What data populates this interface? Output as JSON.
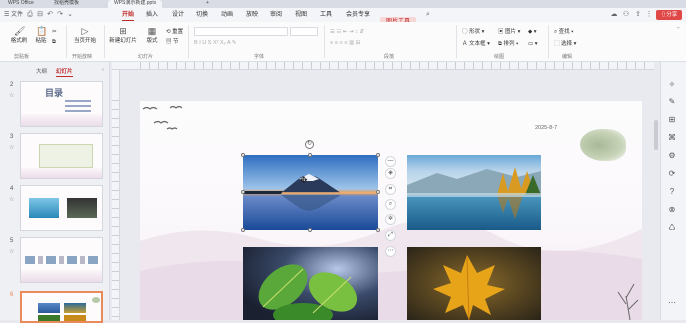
{
  "titlebar": {
    "tabs": [
      {
        "label": "WPS Office"
      },
      {
        "label": "找稻壳模板"
      },
      {
        "label": "WPS演示新建.pptx"
      }
    ],
    "new_tab": "+"
  },
  "menubar": {
    "file_label": "文件",
    "items": [
      "开始",
      "插入",
      "设计",
      "切换",
      "动画",
      "放映",
      "审阅",
      "视图",
      "工具",
      "会员专享"
    ],
    "active_index": 0,
    "picture_tools": "图片工具",
    "share_label": "分享"
  },
  "ribbon": {
    "format_painter": "格式刷",
    "paste": "粘贴",
    "clipboard_group": "剪贴板",
    "play_from_current": "当页开始",
    "play_group": "开始放映",
    "new_slide": "新建幻灯片",
    "layout": "版式",
    "section": "节",
    "reset": "重置",
    "slides_group": "幻灯片",
    "font_group": "字体",
    "paragraph_group": "段落",
    "shape": "形状",
    "textbox": "文本框",
    "picture": "图片",
    "arrange": "排列",
    "drawing_group": "绘图",
    "find": "查找",
    "select": "选择",
    "editing_group": "编辑"
  },
  "leftpanel": {
    "outline_tab": "大纲",
    "slides_tab": "幻灯片",
    "thumbs": [
      {
        "num": "2",
        "title": "目录"
      },
      {
        "num": "3"
      },
      {
        "num": "4"
      },
      {
        "num": "5"
      },
      {
        "num": "6"
      }
    ]
  },
  "slide": {
    "date": "2025-8-7"
  },
  "colors": {
    "accent": "#c02c2c",
    "share": "#e04848",
    "selection_border": "#e88a5a"
  }
}
